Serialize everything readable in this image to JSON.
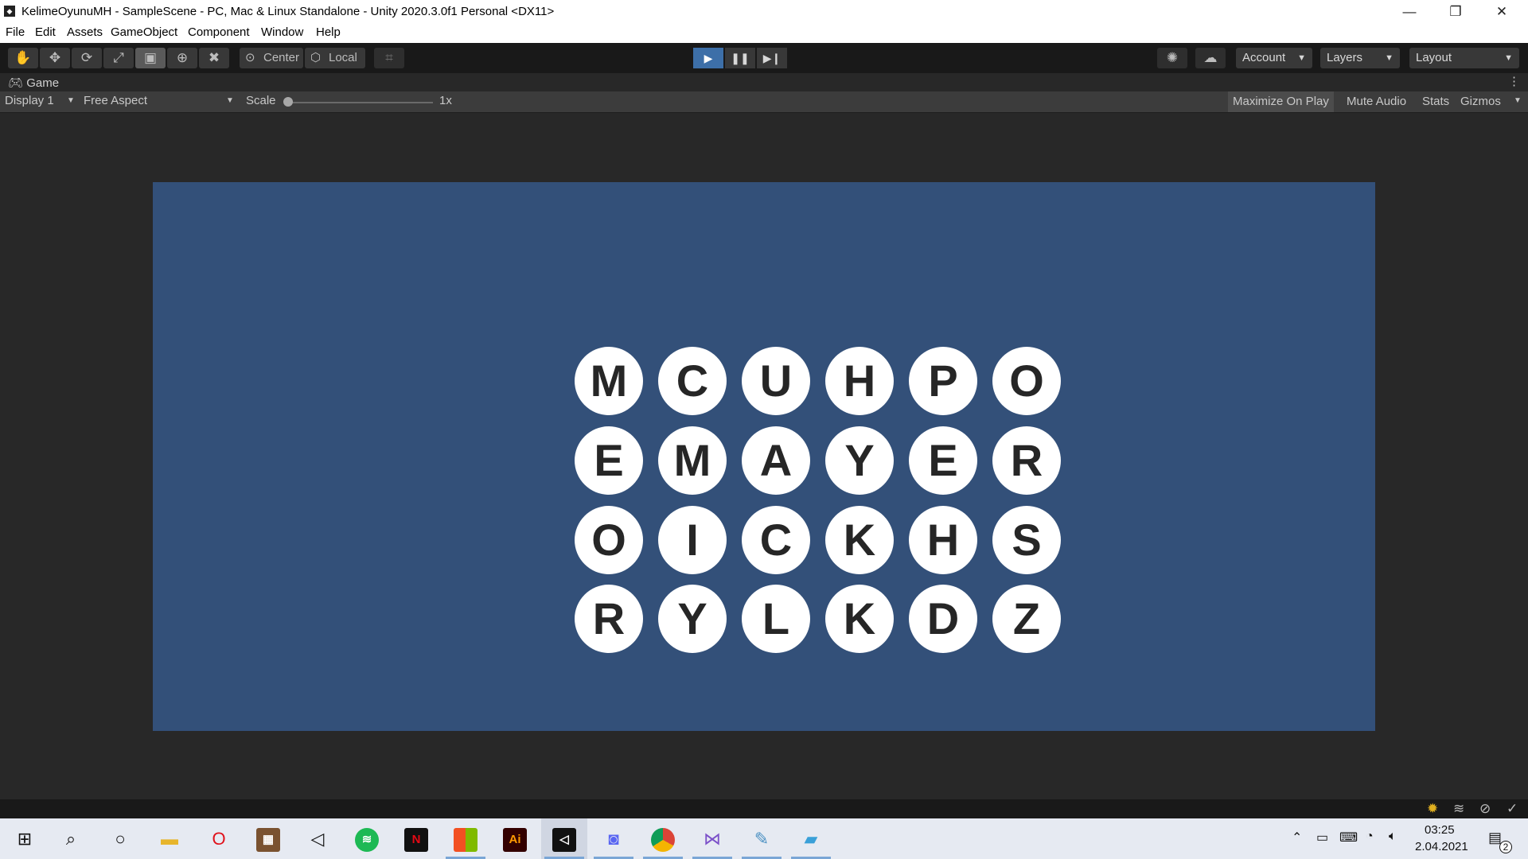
{
  "window": {
    "title": "KelimeOyunuMH - SampleScene - PC, Mac & Linux Standalone - Unity 2020.3.0f1 Personal <DX11>",
    "minimize": "—",
    "restore": "❐",
    "close": "✕"
  },
  "menu": [
    "File",
    "Edit",
    "Assets",
    "GameObject",
    "Component",
    "Window",
    "Help"
  ],
  "toolbar": {
    "tools": [
      "hand-tool-icon",
      "move-tool-icon",
      "rotate-tool-icon",
      "scale-tool-icon",
      "rect-tool-icon",
      "transform-tool-icon",
      "custom-tool-icon"
    ],
    "active_tool": "rect-tool-icon",
    "pivot_center": "Center",
    "pivot_local": "Local",
    "account": "Account",
    "layers": "Layers",
    "layout": "Layout",
    "playing": true
  },
  "game_tab": {
    "label": "Game",
    "display": "Display 1",
    "aspect": "Free Aspect",
    "scale_label": "Scale",
    "scale_value": "1x",
    "maximize_on_play": "Maximize On Play",
    "mute_audio": "Mute Audio",
    "stats": "Stats",
    "gizmos": "Gizmos"
  },
  "game": {
    "background": "#335079",
    "rows": [
      [
        "M",
        "C",
        "U",
        "H",
        "P",
        "O"
      ],
      [
        "E",
        "M",
        "A",
        "Y",
        "E",
        "R"
      ],
      [
        "O",
        "I",
        "C",
        "K",
        "H",
        "S"
      ],
      [
        "R",
        "Y",
        "L",
        "K",
        "D",
        "Z"
      ]
    ]
  },
  "taskbar": {
    "apps": [
      "windows-start-icon",
      "search-icon",
      "cortana-icon",
      "file-explorer-icon",
      "opera-icon",
      "game-app-icon",
      "unity-hub-icon",
      "spotify-icon",
      "netflix-icon",
      "store-icon",
      "illustrator-icon",
      "unity-icon",
      "discord-icon",
      "chrome-icon",
      "visual-studio-icon",
      "paint-icon",
      "notepad-icon"
    ],
    "illustrator_label": "Ai",
    "netflix_label": "N",
    "time": "03:25",
    "date": "2.04.2021",
    "notifications": "2"
  }
}
